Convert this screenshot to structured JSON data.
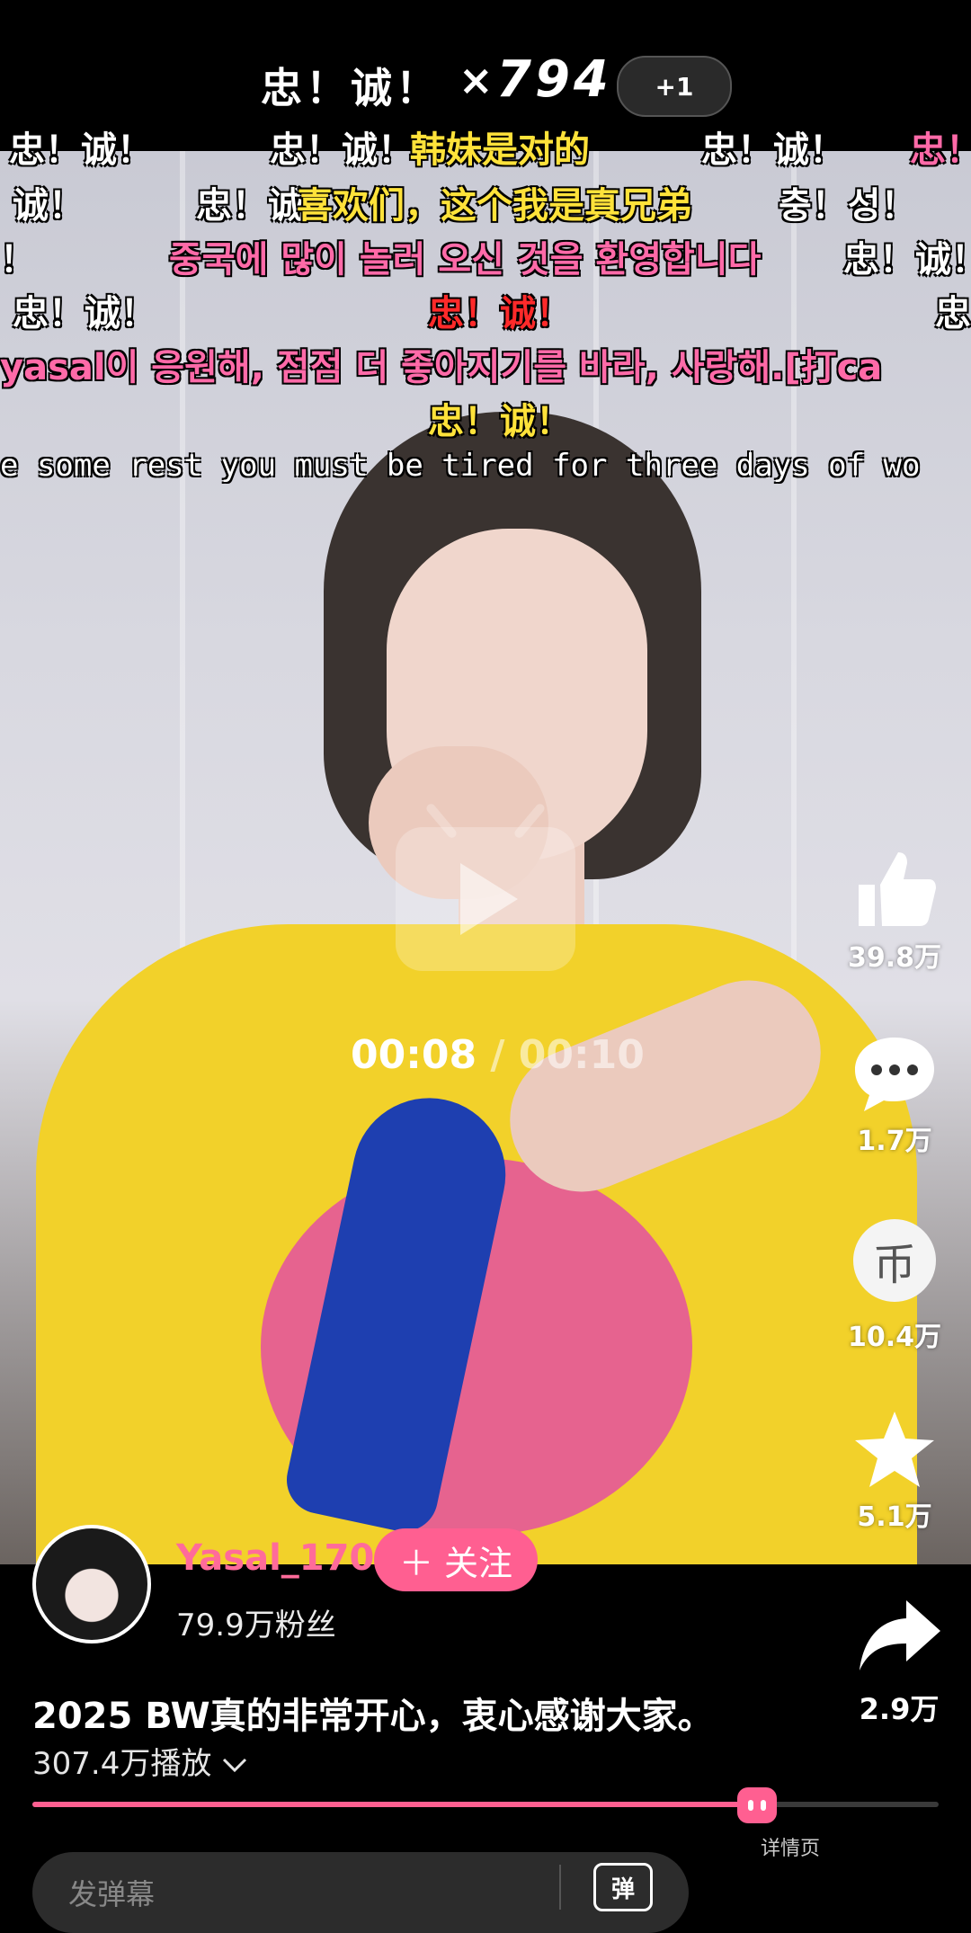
{
  "combo": {
    "text": "忠！诚！",
    "x": "×",
    "count": "794",
    "badge": "+1"
  },
  "danmaku": [
    {
      "text": "忠！诚！",
      "color": "#ffffff"
    },
    {
      "text": "忠！诚！",
      "color": "#ffffff"
    },
    {
      "text": "韩妹是对的",
      "color": "#ffe23a"
    },
    {
      "text": "忠！诚！",
      "color": "#ffffff"
    },
    {
      "text": "忠！",
      "color": "#ff6aa8"
    },
    {
      "text": "诚！",
      "color": "#ffffff"
    },
    {
      "text": "忠！诚",
      "color": "#ffffff"
    },
    {
      "text": "喜欢们，这个我是真兄弟",
      "color": "#ffe23a"
    },
    {
      "text": "충！성！",
      "color": "#ffffff"
    },
    {
      "text": "！",
      "color": "#ffffff"
    },
    {
      "text": "중국에 많이 놀러 오신 것을 환영합니다",
      "color": "#ff6aa8"
    },
    {
      "text": "忠！诚！",
      "color": "#ffffff"
    },
    {
      "text": "忠！诚！",
      "color": "#ffffff"
    },
    {
      "text": "忠！诚！",
      "color": "#ff2a2a"
    },
    {
      "text": "忠",
      "color": "#ffffff"
    },
    {
      "text": "yasal이 응원해, 점점 더 좋아지기를 바라, 사랑해.[打ca",
      "color": "#ff6aa8"
    },
    {
      "text": "忠！诚！",
      "color": "#ffe23a"
    },
    {
      "text": "e some rest you must be tired for three days of wo",
      "color": "#ffffff"
    }
  ],
  "player": {
    "current_time": "00:08",
    "separator": " / ",
    "total_time": "00:10",
    "progress": 0.8
  },
  "actions": {
    "like_count": "39.8万",
    "comment_count": "1.7万",
    "coin_count": "10.4万",
    "coin_glyph": "币",
    "favorite_count": "5.1万",
    "share_count": "2.9万"
  },
  "author": {
    "name": "Yasal_170",
    "follow_label": "＋ 关注",
    "fans": "79.9万粉丝"
  },
  "video": {
    "title": "2025 BW真的非常开心，衷心感谢大家。",
    "plays": "307.4万播放"
  },
  "progress_thumb_label": "详情页",
  "comment_input": {
    "placeholder": "发弹幕",
    "danmu_button": "弹"
  },
  "icons": [
    "like-icon",
    "comment-icon",
    "coin-icon",
    "favorite-icon",
    "share-icon",
    "play-icon",
    "chevron-down-icon"
  ],
  "colors": {
    "accent": "#ff5f91",
    "background": "#000000"
  }
}
